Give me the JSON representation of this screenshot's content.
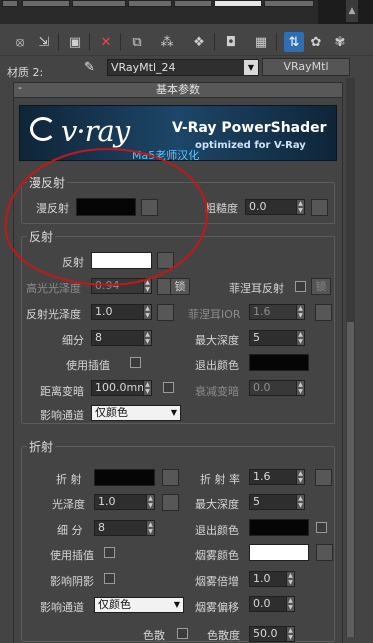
{
  "material_row": {
    "label": "材质 2:",
    "material_name": "VRayMtl_24",
    "type_button": "VRayMtl"
  },
  "rollout": {
    "title": "基本参数",
    "collapse_symbol": "-"
  },
  "banner": {
    "logo": "v·ray",
    "title": "V-Ray PowerShader",
    "subtitle": "optimized for V-Ray",
    "credit": "Ma5老师汉化"
  },
  "diffuse": {
    "group_title": "漫反射",
    "diffuse_label": "漫反射",
    "roughness_label": "粗糙度",
    "roughness_value": "0.0"
  },
  "reflection": {
    "group_title": "反射",
    "reflect_label": "反射",
    "hilight_gloss_label": "高光光泽度",
    "hilight_gloss_value": "0.94",
    "lock_label": "锁",
    "fresnel_label": "菲涅耳反射",
    "fresnel_lock_label": "锁",
    "refl_gloss_label": "反射光泽度",
    "refl_gloss_value": "1.0",
    "fresnel_ior_label": "菲涅耳IOR",
    "fresnel_ior_value": "1.6",
    "subdivs_label": "细分",
    "subdivs_value": "8",
    "max_depth_label": "最大深度",
    "max_depth_value": "5",
    "use_interp_label": "使用插值",
    "exit_color_label": "退出颜色",
    "dim_distance_label": "距离变暗",
    "dim_distance_value": "100.0mm",
    "dim_falloff_label": "衰减变暗",
    "dim_falloff_value": "0.0",
    "affect_channels_label": "影响通道",
    "affect_channels_value": "仅颜色"
  },
  "refraction": {
    "group_title": "折射",
    "refract_label": "折 射",
    "ior_label": "折 射 率",
    "ior_value": "1.6",
    "gloss_label": "光泽度",
    "gloss_value": "1.0",
    "max_depth_label": "最大深度",
    "max_depth_value": "5",
    "subdivs_label": "细 分",
    "subdivs_value": "8",
    "exit_color_label": "退出颜色",
    "use_interp_label": "使用插值",
    "fog_color_label": "烟雾颜色",
    "affect_shadows_label": "影响阴影",
    "fog_mult_label": "烟雾倍增",
    "fog_mult_value": "1.0",
    "affect_channels_label": "影响通道",
    "affect_channels_value": "仅颜色",
    "fog_bias_label": "烟雾偏移",
    "fog_bias_value": "0.0",
    "dispersion_label": "色散",
    "abbe_label": "色散度",
    "abbe_value": "50.0"
  },
  "colors": {
    "swatch_black": "#050505",
    "swatch_white": "#ffffff",
    "annotation_red": "#c41818",
    "active_tool_blue": "#2c6fb3"
  },
  "icons": [
    "pick-material-icon",
    "put-to-scene-icon",
    "assign-material-icon",
    "reset-map-icon",
    "make-copy-icon",
    "make-unique-icon",
    "put-to-library-icon",
    "material-id-icon",
    "show-map-icon",
    "show-end-result-icon",
    "go-to-parent-icon",
    "go-forward-icon",
    "eyedropper-icon"
  ]
}
